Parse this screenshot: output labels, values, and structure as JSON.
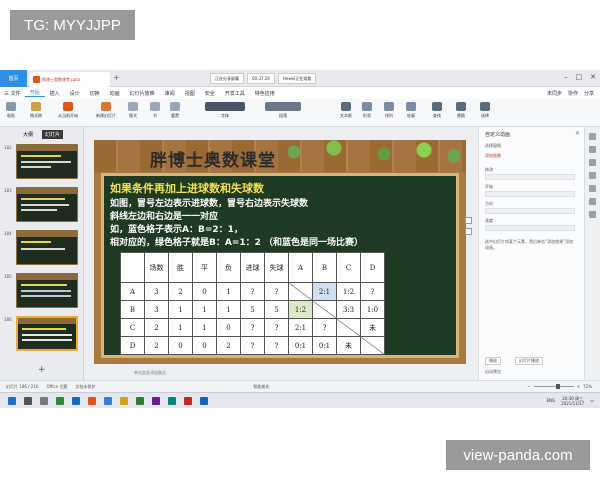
{
  "watermarks": {
    "top": "TG: MYYJJPP",
    "bottom": "view-panda.com"
  },
  "tabbar": {
    "home_label": "首页",
    "doc_tab": "胖博士奥数课堂.pptx",
    "meeting_info": [
      "正在分享屏幕",
      "00:37:26",
      "Hewei正在观看"
    ]
  },
  "menubar": {
    "file": "三 文件",
    "items": [
      "开始",
      "插入",
      "设计",
      "切换",
      "动画",
      "幻灯片放映",
      "审阅",
      "视图",
      "安全",
      "开发工具",
      "特色应用"
    ],
    "active_index": 0,
    "right": [
      "未同步",
      "协作",
      "分享"
    ]
  },
  "ribbon": {
    "buttons": [
      "粘贴",
      "格式刷",
      "从当前开始",
      "新建幻灯片",
      "版式",
      "节",
      "重置",
      "字体",
      "段落",
      "文本框",
      "形状",
      "排列",
      "轮廓",
      "查找",
      "替换",
      "选择"
    ]
  },
  "left_panel": {
    "tabs": [
      "大纲",
      "幻灯片"
    ],
    "active_tab": 1,
    "slide_numbers": [
      "182",
      "183",
      "184",
      "185",
      "186"
    ],
    "selected_slide": 4
  },
  "slide": {
    "title": "胖博士奥数课堂",
    "heading": "如果条件再加上进球数和失球数",
    "lines": [
      "如图，冒号左边表示进球数，冒号右边表示失球数",
      "斜线左边和右边是一一对应",
      "如，蓝色格子表示A：B=2：1，",
      "相对应的，绿色格子就是B：A=1：2  （和蓝色是同一场比赛）"
    ],
    "table": {
      "header": [
        "",
        "场数",
        "胜",
        "平",
        "负",
        "进球",
        "失球",
        "A",
        "B",
        "C",
        "D"
      ],
      "rows": [
        [
          "A",
          "3",
          "2",
          "0",
          "1",
          "?",
          "?",
          "",
          "2:1",
          "1:2",
          "?"
        ],
        [
          "B",
          "3",
          "1",
          "1",
          "1",
          "5",
          "5",
          "1:2",
          "",
          "3:3",
          "1:0"
        ],
        [
          "C",
          "2",
          "1",
          "1",
          "0",
          "?",
          "?",
          "2:1",
          "?",
          "",
          "未"
        ],
        [
          "D",
          "2",
          "0",
          "0",
          "2",
          "?",
          "?",
          "0:1",
          "0:1",
          "未",
          ""
        ]
      ]
    }
  },
  "notes_placeholder": "单击此处添加备注",
  "right_panel": {
    "title": "自定义动画",
    "items": [
      "选择窗格",
      "添加效果",
      "修改",
      "开始",
      "方向",
      "速度",
      "选中幻灯片的某个元素，然后单击“添加效果”添加动画。"
    ],
    "buttons": [
      "播放",
      "幻灯片播放"
    ],
    "checkbox": "自动预览"
  },
  "statusbar": {
    "slide_info": "幻灯片 186 / 216",
    "theme": "Office 主题",
    "notes_toggle": "文档未保护",
    "smart": "智能美化",
    "zoom": "72%"
  },
  "taskbar": {
    "time": "20:30 周三",
    "date": "2021/11/17",
    "lang": "ENG"
  },
  "colors": {
    "accent": "#2f8fe3",
    "board": "#1f3a22",
    "heading_yellow": "#f2e24a",
    "blue_cell": "#cfe0f1",
    "green_cell": "#dbe9c9"
  }
}
